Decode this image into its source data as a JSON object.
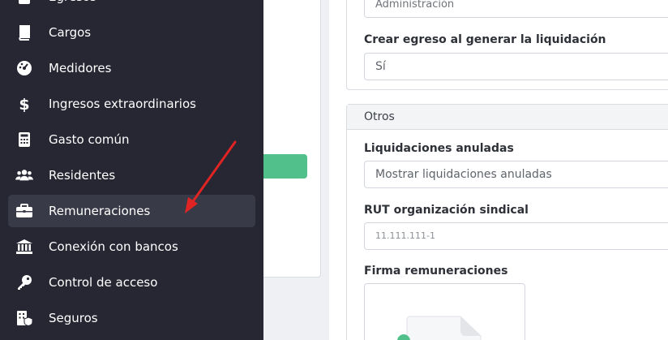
{
  "sidebar": {
    "items": [
      {
        "label": "Egresos",
        "icon": "receipt-icon"
      },
      {
        "label": "Cargos",
        "icon": "book-icon"
      },
      {
        "label": "Medidores",
        "icon": "gauge-icon"
      },
      {
        "label": "Ingresos extraordinarios",
        "icon": "dollar-icon"
      },
      {
        "label": "Gasto común",
        "icon": "calculator-icon"
      },
      {
        "label": "Residentes",
        "icon": "users-icon"
      },
      {
        "label": "Remuneraciones",
        "icon": "briefcase-icon",
        "active": true
      },
      {
        "label": "Conexión con bancos",
        "icon": "bank-icon"
      },
      {
        "label": "Control de acceso",
        "icon": "key-icon"
      },
      {
        "label": "Seguros",
        "icon": "building-shield-icon"
      }
    ]
  },
  "form": {
    "top_field_value": "Administración",
    "crear_egreso_label": "Crear egreso al generar la liquidación",
    "crear_egreso_value": "Sí",
    "otros_title": "Otros",
    "liquidaciones_label": "Liquidaciones anuladas",
    "liquidaciones_value": "Mostrar liquidaciones anuladas",
    "rut_label": "RUT organización sindical",
    "rut_placeholder": "11.111.111-1",
    "firma_label": "Firma remuneraciones"
  },
  "colors": {
    "sidebar_bg": "#262733",
    "sidebar_active": "#393a47",
    "accent_green": "#52c08a",
    "annotation_arrow": "#e02424"
  }
}
